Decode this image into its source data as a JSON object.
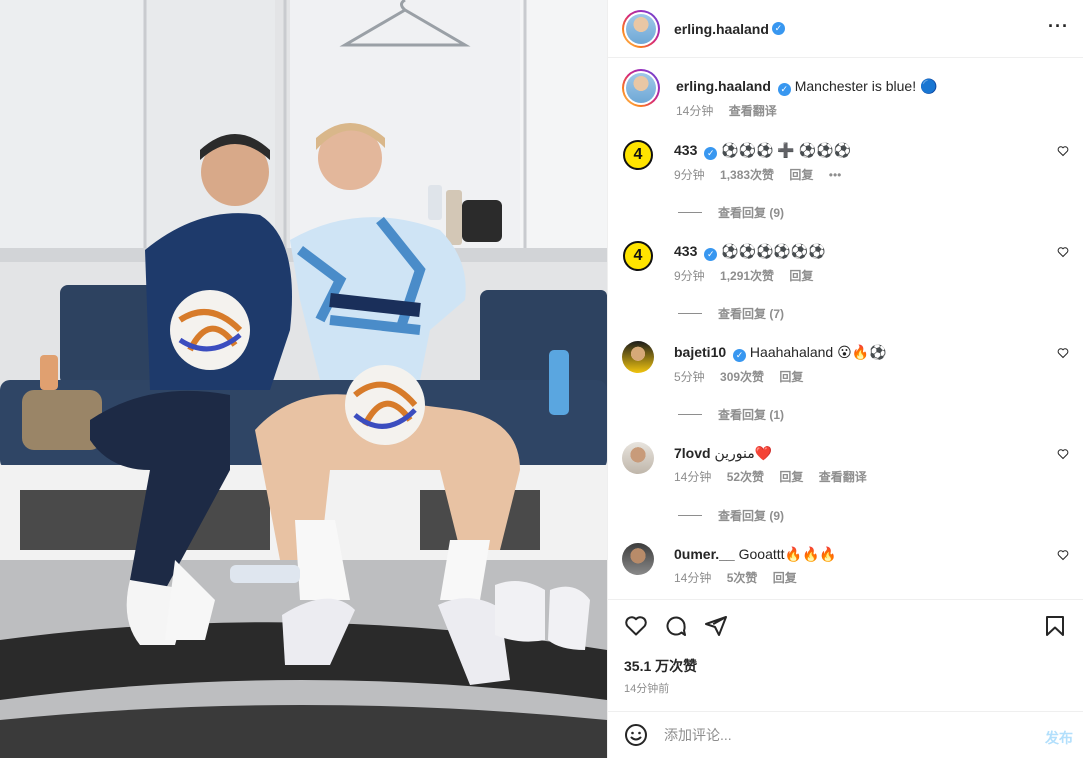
{
  "photo": {
    "alt_icon": "locker-room-photo"
  },
  "header": {
    "username": "erling.haaland",
    "more_icon": "more-horizontal-icon"
  },
  "caption": {
    "username": "erling.haaland",
    "text": "Manchester is blue! 🔵",
    "time": "14分钟",
    "translate": "查看翻译"
  },
  "comments": [
    {
      "username": "433",
      "verified": true,
      "text": "⚽⚽⚽ ➕ ⚽⚽⚽",
      "time": "9分钟",
      "likes": "1,383次赞",
      "reply": "回复",
      "extra": "•••",
      "view_replies": "查看回复 (9)"
    },
    {
      "username": "433",
      "verified": true,
      "text": "⚽⚽⚽⚽⚽⚽",
      "time": "9分钟",
      "likes": "1,291次赞",
      "reply": "回复",
      "view_replies": "查看回复 (7)"
    },
    {
      "username": "bajeti10",
      "verified": true,
      "text": "Haahahaland 😮🔥⚽",
      "time": "5分钟",
      "likes": "309次赞",
      "reply": "回复",
      "view_replies": "查看回复 (1)"
    },
    {
      "username": "7lovd",
      "verified": false,
      "text": "منورين❤️",
      "time": "14分钟",
      "likes": "52次赞",
      "reply": "回复",
      "translate": "查看翻译",
      "view_replies": "查看回复 (9)"
    },
    {
      "username": "0umer.__",
      "verified": false,
      "text": "Gooattt🔥🔥🔥",
      "time": "14分钟",
      "likes": "5次赞",
      "reply": "回复"
    }
  ],
  "actions": {
    "likes": "35.1 万次赞",
    "time": "14分钟前"
  },
  "add_comment": {
    "placeholder": "添加评论...",
    "post_label": "发布"
  },
  "colors": {
    "accent": "#0095f6",
    "verified": "#3897f0",
    "muted": "#8e8e8e"
  }
}
